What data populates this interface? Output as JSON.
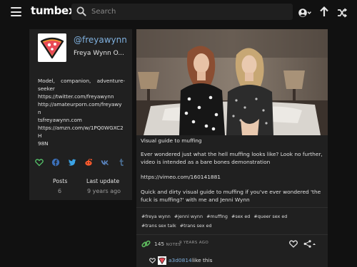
{
  "header": {
    "logo": "tumbex",
    "search_placeholder": "Search",
    "icons": [
      "menu-icon",
      "search-icon",
      "account-icon",
      "chevron-down-icon",
      "arrow-up-icon",
      "random-icon"
    ]
  },
  "profile": {
    "username": "@freyawynn",
    "display_name": "Freya Wynn O...",
    "bio_lines": [
      "Model, companion, adventure-",
      "seeker",
      "https://twitter.com/freyawynn",
      "http://amateurporn.com/freyawyn",
      "tsfreyawynn.com",
      "https://amzn.com/w/1PQ0WGXC2H",
      "98N"
    ],
    "share_icons": [
      "heart-icon",
      "facebook-icon",
      "twitter-icon",
      "reddit-icon",
      "vk-icon",
      "tumblr-icon"
    ],
    "stats": {
      "posts_label": "Posts",
      "posts_value": "6",
      "update_label": "Last update",
      "update_value": "9 years ago"
    }
  },
  "post": {
    "title": "Visual guide to muffing",
    "paragraphs": [
      "Ever wondered just what the hell muffing looks like? Look no further, video is intended as a bare bones demonstration",
      "https://vimeo.com/160141881",
      "Quick and dirty visual guide to muffing if you've ever wondered 'the fuck is muffing?' with me and Jenni Wynn"
    ],
    "tags": [
      "#freya wynn",
      "#jenni wynn",
      "#muffing",
      "#sex ed",
      "#queer sex ed",
      "#trans sex talk",
      "#trans sex ed"
    ],
    "notes_count": "145",
    "notes_word": "NOTES",
    "time_ago": "9 YEARS AGO",
    "note_user": "a3d0814",
    "note_action": "like this"
  },
  "colors": {
    "background": "#111111",
    "card": "#202020",
    "accent_link": "#7fb0de",
    "reblog_green": "#5cb85c"
  }
}
